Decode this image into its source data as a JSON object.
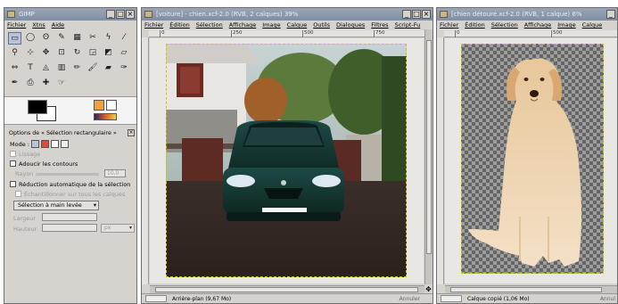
{
  "toolbox": {
    "title": "GIMP",
    "menu": [
      "Fichier",
      "Xtns",
      "Aide"
    ],
    "tool_icons": [
      "rect-select-icon",
      "ellipse-select-icon",
      "free-select-icon",
      "fuzzy-select-icon",
      "color-select-icon",
      "scissors-icon",
      "paths-icon",
      "pick-color-icon",
      "zoom-icon",
      "measure-icon",
      "move-icon",
      "crop-icon",
      "rotate-icon",
      "scale-icon",
      "shear-icon",
      "perspective-icon",
      "flip-icon",
      "text-icon",
      "bucket-fill-icon",
      "blend-icon",
      "pencil-icon",
      "paintbrush-icon",
      "eraser-icon",
      "airbrush-icon",
      "ink-icon",
      "clone-icon",
      "heal-icon",
      "smudge-icon"
    ],
    "tool_glyphs": [
      "▭",
      "◯",
      "ʘ",
      "✎",
      "▦",
      "✂",
      "ϟ",
      "⁄",
      "⚲",
      "⊹",
      "✥",
      "⊡",
      "↻",
      "◲",
      "◩",
      "▱",
      "⇔",
      "T",
      "◬",
      "▥",
      "✏",
      "🖌",
      "▰",
      "✑",
      "✒",
      "⎙",
      "✚",
      "☞"
    ],
    "options_title": "Options de « Sélection rectangulaire »",
    "mode_label": "Mode :",
    "lissage": "Lissage",
    "adoucir": "Adoucir les contours",
    "rayon_label": "Rayon :",
    "rayon_value": "10,0",
    "reduction": "Réduction automatique de la sélection",
    "echantillonner": "Échantillonner sur tous les calques",
    "selection_mode": "Sélection à main levée",
    "largeur": "Largeur",
    "hauteur": "Hauteur",
    "px": "px"
  },
  "car_window": {
    "title": "[voiture] - chien.xcf-2.0 (RVB, 2 calques) 39%",
    "menu": [
      "Fichier",
      "Édition",
      "Sélection",
      "Affichage",
      "Image",
      "Calque",
      "Outils",
      "Dialogues",
      "Filtres",
      "Script-Fu"
    ],
    "ruler_ticks": [
      "0",
      "250",
      "500",
      "750",
      "1000"
    ],
    "status": "Arrière-plan (9,67 Mo)",
    "cancel": "Annuler"
  },
  "dog_window": {
    "title": "[chien détouré.xcf-2.0 (RVB, 1 calque) 6%",
    "menu": [
      "Fichier",
      "Édition",
      "Sélection",
      "Affichage",
      "Image",
      "Calque"
    ],
    "ruler_ticks": [
      "0",
      "500"
    ],
    "status": "Calque copié (1,06 Mo)",
    "cancel": "Annul"
  },
  "colors": {
    "titlebar": "#8594aa",
    "chrome": "#d6d3ce",
    "selection_dash": "#d7c400"
  }
}
